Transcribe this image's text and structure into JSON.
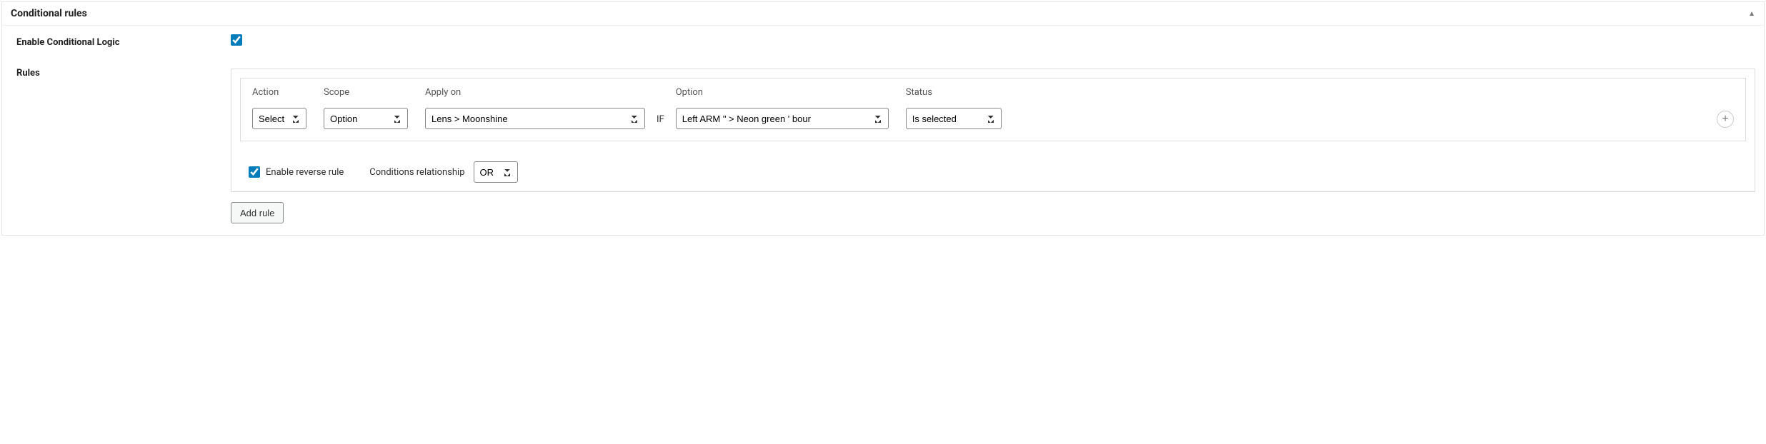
{
  "panel": {
    "title": "Conditional rules"
  },
  "labels": {
    "enable": "Enable Conditional Logic",
    "rules": "Rules"
  },
  "enable_checked": true,
  "rule": {
    "headers": {
      "action": "Action",
      "scope": "Scope",
      "apply_on": "Apply on",
      "option": "Option",
      "status": "Status"
    },
    "if_label": "IF",
    "values": {
      "action": "Select",
      "scope": "Option",
      "apply_on": "Lens > Moonshine",
      "option": "Left ARM \" > Neon green ' bour",
      "status": "Is selected"
    }
  },
  "footer": {
    "reverse_checked": true,
    "reverse_label": "Enable reverse rule",
    "relationship_label": "Conditions relationship",
    "relationship_value": "OR"
  },
  "buttons": {
    "add_rule": "Add rule"
  }
}
